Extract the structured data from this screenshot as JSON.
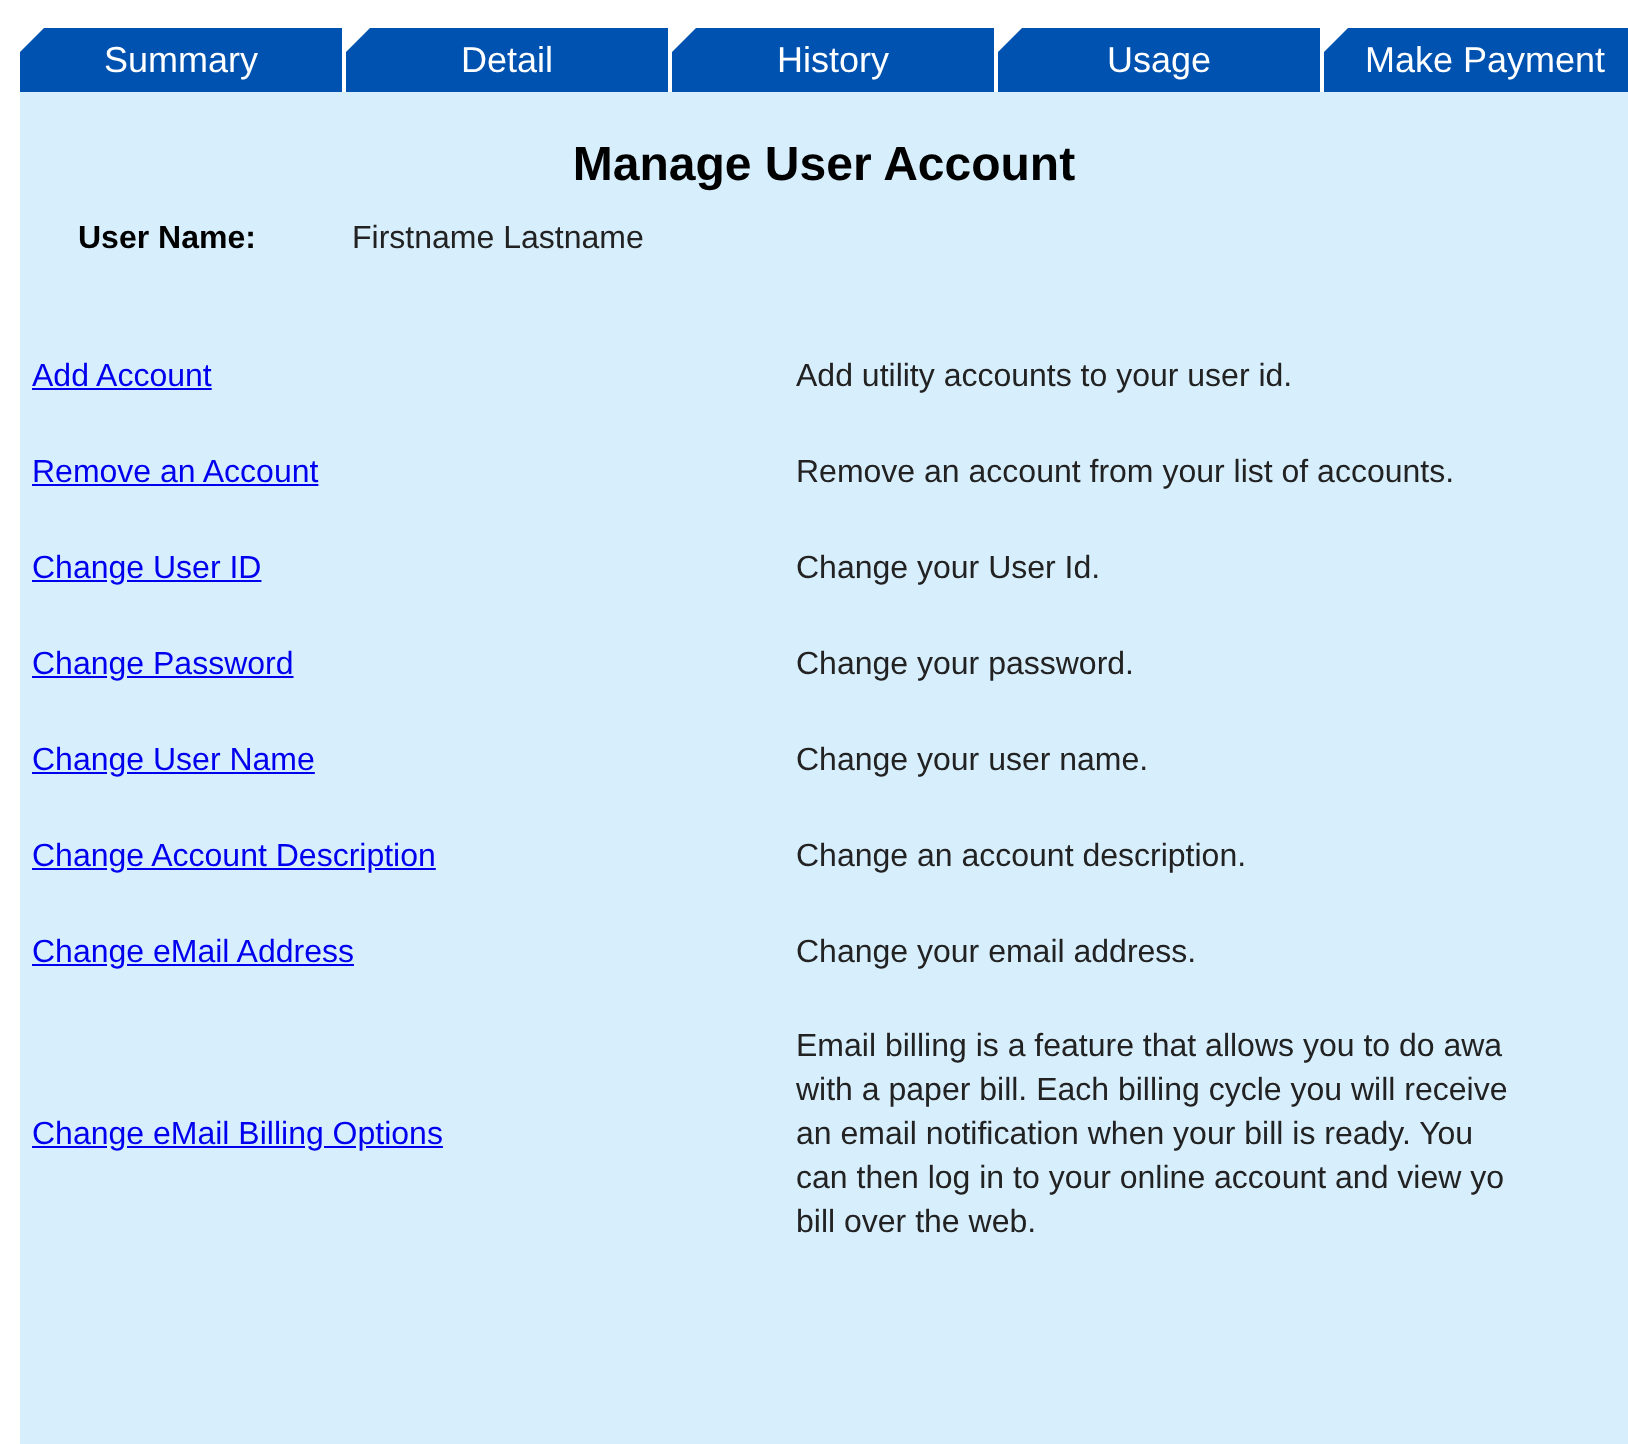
{
  "tabs": [
    {
      "label": "Summary"
    },
    {
      "label": "Detail"
    },
    {
      "label": "History"
    },
    {
      "label": "Usage"
    },
    {
      "label": "Make Payment"
    }
  ],
  "title": "Manage User Account",
  "user_name": {
    "label": "User Name:",
    "value": "Firstname Lastname"
  },
  "options": [
    {
      "link": "Add Account",
      "description": [
        "Add utility accounts to your user id."
      ]
    },
    {
      "link": "Remove an Account",
      "description": [
        "Remove an account from your list of accounts."
      ]
    },
    {
      "link": "Change User ID",
      "description": [
        "Change your User Id."
      ]
    },
    {
      "link": "Change Password",
      "description": [
        "Change your password."
      ]
    },
    {
      "link": "Change User Name",
      "description": [
        "Change your user name."
      ]
    },
    {
      "link": "Change Account Description",
      "description": [
        "Change an account description."
      ]
    },
    {
      "link": "Change eMail Address",
      "description": [
        "Change your email address."
      ]
    },
    {
      "link": "Change eMail Billing Options",
      "description": [
        "Email billing is a feature that allows you to do awa",
        "with a paper bill. Each billing cycle you will receive",
        "an email notification when your bill is ready. You",
        "can then log in to your online account and view yo",
        "bill over the web."
      ]
    }
  ]
}
